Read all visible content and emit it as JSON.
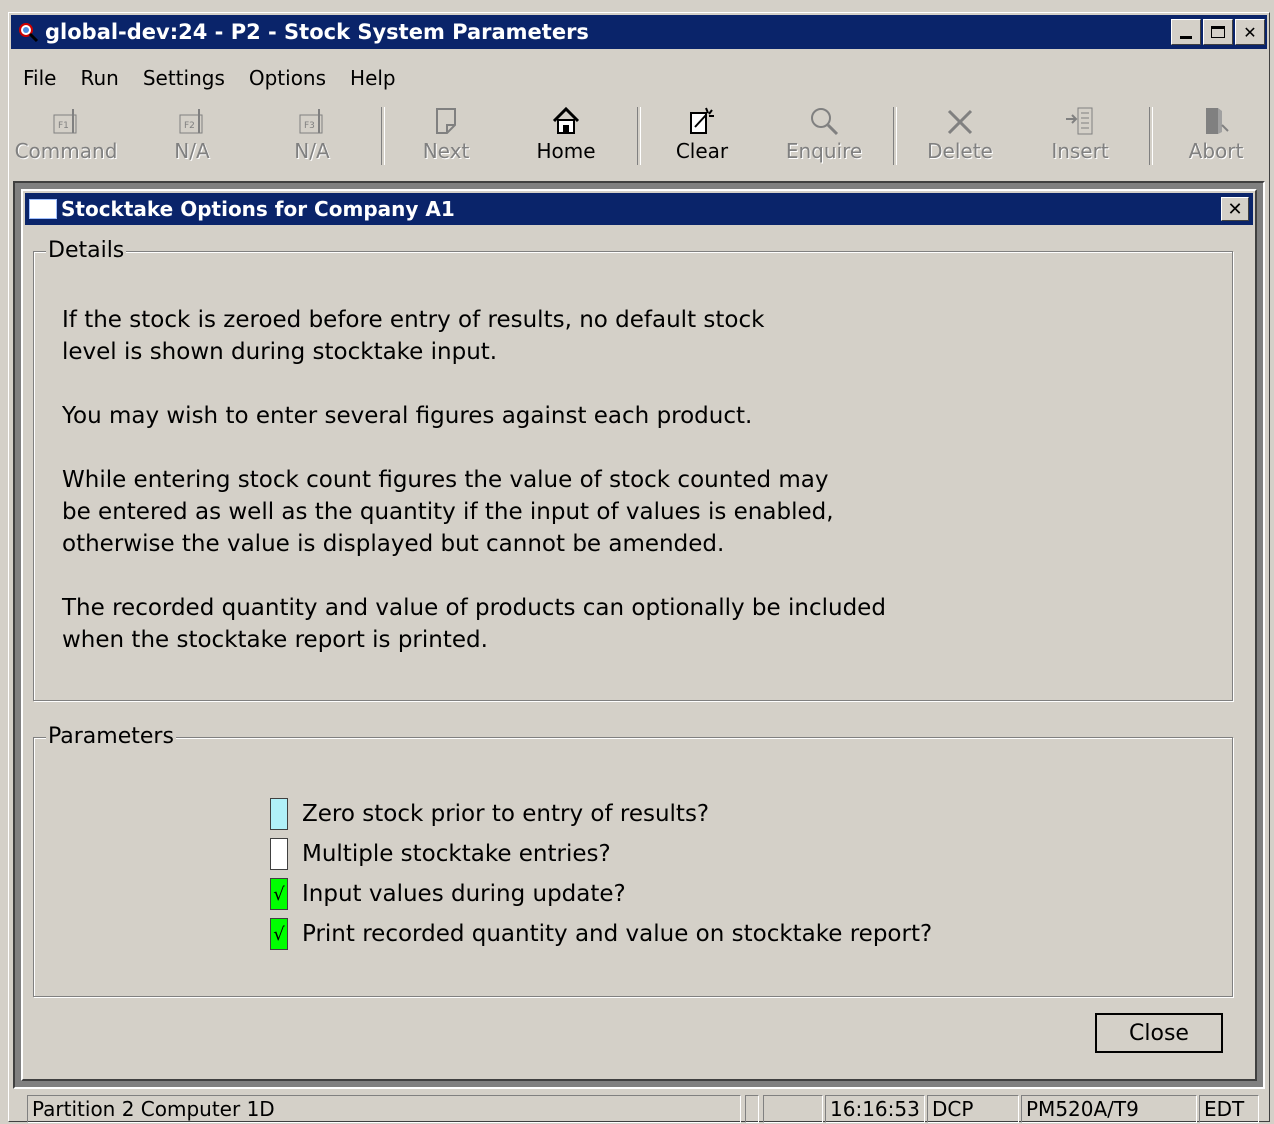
{
  "window": {
    "title": "global-dev:24 - P2 - Stock System Parameters"
  },
  "menu": [
    "File",
    "Run",
    "Settings",
    "Options",
    "Help"
  ],
  "toolbar": [
    {
      "label": "Command",
      "icon": "f1-key-icon",
      "enabled": false
    },
    {
      "label": "N/A",
      "icon": "f2-key-icon",
      "enabled": false
    },
    {
      "label": "N/A",
      "icon": "f3-key-icon",
      "enabled": false
    },
    {
      "label": "Next",
      "icon": "page-icon",
      "enabled": false
    },
    {
      "label": "Home",
      "icon": "home-icon",
      "enabled": true
    },
    {
      "label": "Clear",
      "icon": "clear-icon",
      "enabled": true
    },
    {
      "label": "Enquire",
      "icon": "magnifier-icon",
      "enabled": false
    },
    {
      "label": "Delete",
      "icon": "x-icon",
      "enabled": false
    },
    {
      "label": "Insert",
      "icon": "insert-icon",
      "enabled": false
    },
    {
      "label": "Abort",
      "icon": "door-icon",
      "enabled": false
    }
  ],
  "dialog": {
    "title": "Stocktake Options for Company A1",
    "details_legend": "Details",
    "details": [
      "If the stock is zeroed before entry of results, no default stock\nlevel is shown during stocktake input.",
      "You may wish to enter several figures against each product.",
      "While entering stock count figures the value of stock counted may\nbe entered as well as the quantity if the input of values is enabled,\notherwise the value is displayed but cannot be amended.",
      "The recorded quantity and value of products can optionally be included\nwhen the stocktake report is printed."
    ],
    "parameters_legend": "Parameters",
    "parameters": [
      {
        "label": "Zero stock prior to entry of results?",
        "checked": false,
        "focused": true
      },
      {
        "label": "Multiple stocktake entries?",
        "checked": false,
        "focused": false
      },
      {
        "label": "Input values during update?",
        "checked": true,
        "focused": false
      },
      {
        "label": "Print recorded quantity and value on stocktake report?",
        "checked": true,
        "focused": false
      }
    ],
    "check_mark": "√",
    "close_label": "Close"
  },
  "status": {
    "partition": "Partition 2 Computer 1D",
    "time": "16:16:53",
    "user": "DCP",
    "program": "PM520A/T9",
    "mode": "EDT"
  },
  "colors": {
    "title_bar": "#0a246a",
    "face": "#d4d0c8",
    "focus_field": "#b0f0f8",
    "checked_field": "#00ff00"
  }
}
